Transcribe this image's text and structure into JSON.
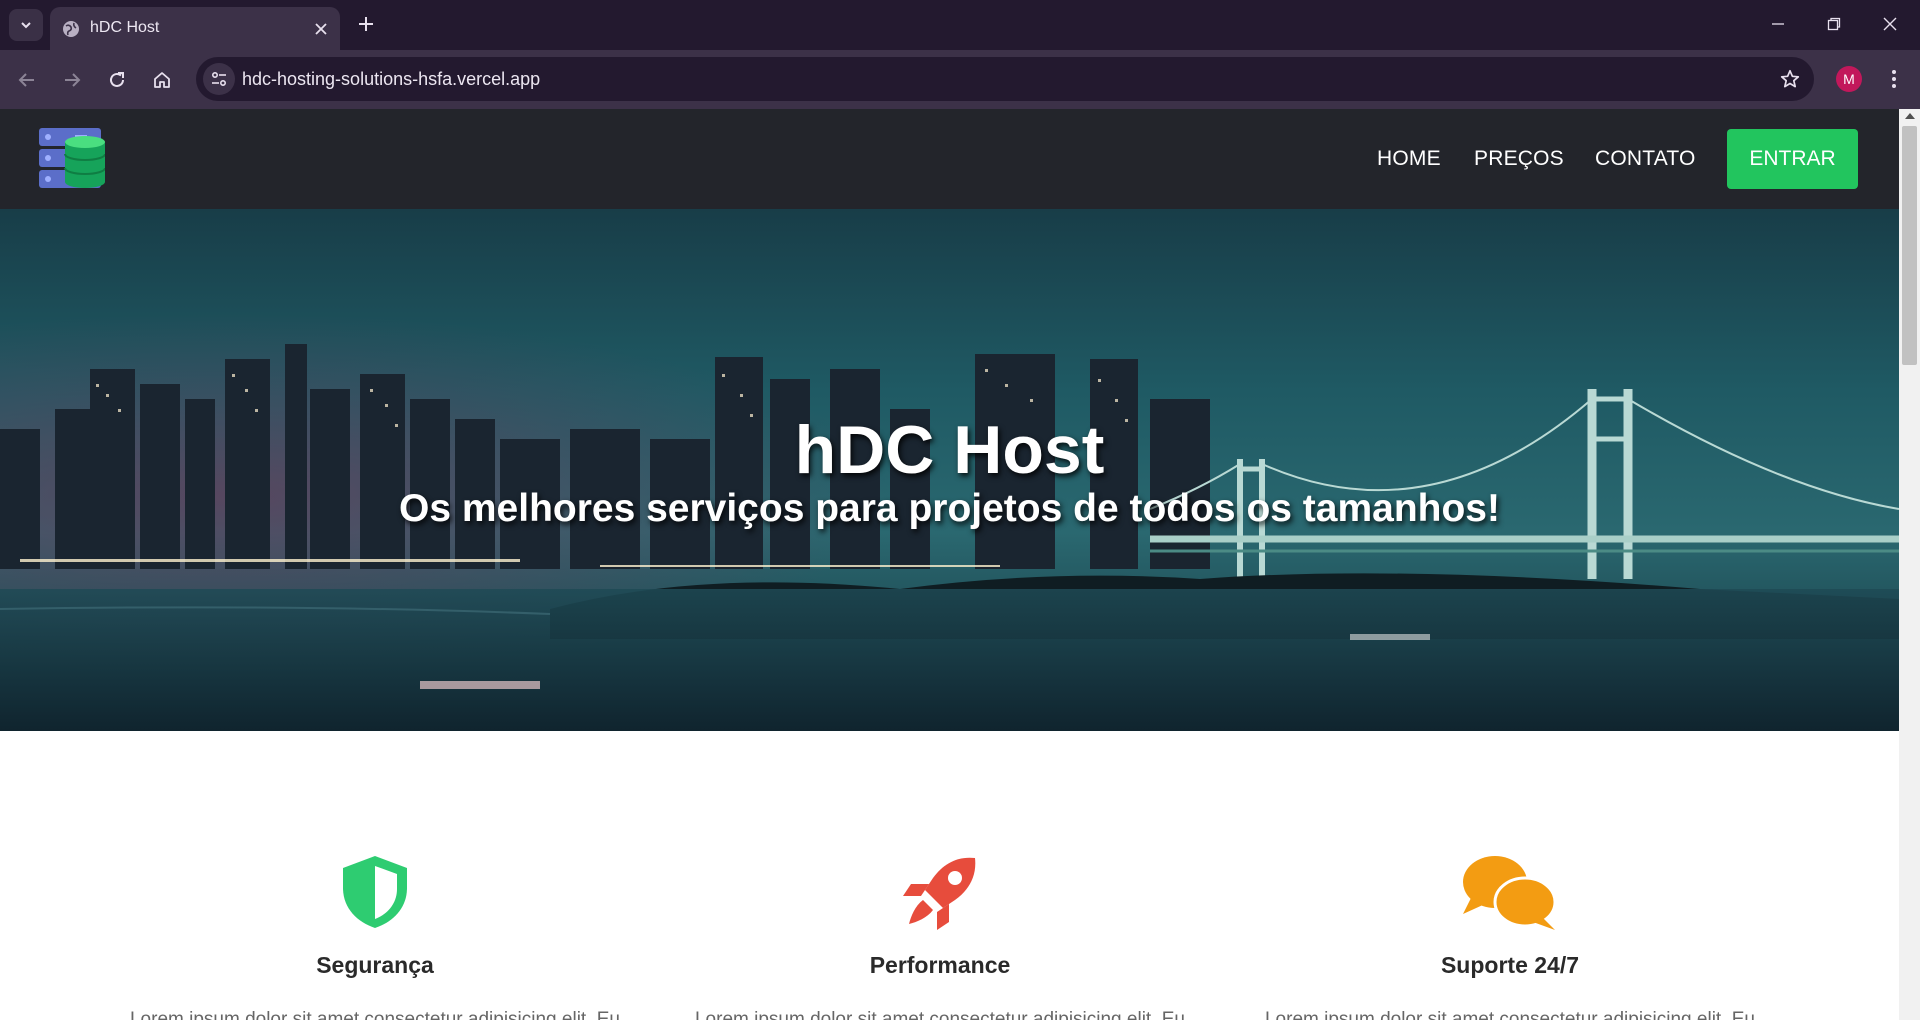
{
  "browser": {
    "tab_title": "hDC Host",
    "url": "hdc-hosting-solutions-hsfa.vercel.app",
    "profile_initial": "M"
  },
  "header": {
    "nav": [
      {
        "label": "HOME"
      },
      {
        "label": "PREÇOS"
      },
      {
        "label": "CONTATO"
      }
    ],
    "cta_label": "ENTRAR"
  },
  "hero": {
    "title": "hDC Host",
    "subtitle": "Os melhores serviços para projetos de todos os tamanhos!"
  },
  "features": [
    {
      "title": "Segurança",
      "icon": "shield-icon",
      "color": "#2ecc71",
      "text": "Lorem ipsum dolor sit amet consectetur adipisicing elit. Eu"
    },
    {
      "title": "Performance",
      "icon": "rocket-icon",
      "color": "#e74c3c",
      "text": "Lorem ipsum dolor sit amet consectetur adipisicing elit. Eu"
    },
    {
      "title": "Suporte 24/7",
      "icon": "chat-bubbles-icon",
      "color": "#f39c12",
      "text": "Lorem ipsum dolor sit amet consectetur adipisicing elit. Eu"
    }
  ],
  "colors": {
    "accent": "#22c55e",
    "header_bg": "#23252b",
    "chrome_bg": "#23192f"
  }
}
